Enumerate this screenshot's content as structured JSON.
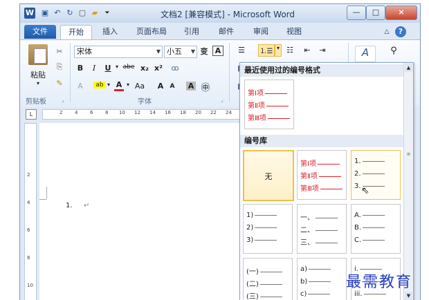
{
  "window": {
    "title": "文档2 [兼容模式] - Microsoft Word",
    "app_icon_letter": "W",
    "controls": {
      "minimize": "—",
      "maximize": "□",
      "close": "×"
    }
  },
  "quick_access": {
    "save": "▣",
    "undo": "↶",
    "redo": "↻",
    "new": "▢",
    "open": "▰",
    "more": "⏷"
  },
  "tabs": [
    {
      "label": "文件"
    },
    {
      "label": "开始"
    },
    {
      "label": "插入"
    },
    {
      "label": "页面布局"
    },
    {
      "label": "引用"
    },
    {
      "label": "邮件"
    },
    {
      "label": "审阅"
    },
    {
      "label": "视图"
    }
  ],
  "tabs_right": {
    "collapse": "△",
    "help": "?"
  },
  "ribbon": {
    "clipboard": {
      "paste_label": "粘贴",
      "group_label": "剪贴板",
      "cut": "✂",
      "copy": "⎘",
      "format_painter": "✎"
    },
    "font": {
      "font_name": "宋体",
      "font_size": "小五",
      "group_label": "字体",
      "bold": "B",
      "italic": "I",
      "underline": "U",
      "strike": "abe",
      "subscript": "x₂",
      "superscript": "x²",
      "highlight": "ab",
      "font_color": "A",
      "change_case": "Aa",
      "grow": "A",
      "shrink": "A",
      "wen": "变",
      "border": "A",
      "enclose": "㊥",
      "clear_format": "ꝏ"
    },
    "paragraph": {
      "bullets": "☰",
      "numbering": "⒈☰",
      "multilevel": "☷",
      "decrease_indent": "⇤",
      "increase_indent": "⇥"
    },
    "styles": {
      "style_icon": "A"
    },
    "editing": {
      "find_icon": "🔍"
    }
  },
  "ruler": {
    "ticks": [
      "2",
      "4",
      "6",
      "8",
      "10",
      "12",
      "14",
      "16",
      "18",
      "20",
      "22",
      "24"
    ]
  },
  "vruler": {
    "ticks": [
      "2",
      "4",
      "6",
      "8",
      "10"
    ]
  },
  "document": {
    "list_number": "1.",
    "return_mark": "↵"
  },
  "numbering_panel": {
    "recent_header": "最近使用过的编号格式",
    "library_header": "编号库",
    "recent": [
      {
        "lines": [
          "第Ⅰ项",
          "第Ⅱ项",
          "第Ⅲ项"
        ]
      }
    ],
    "library": [
      {
        "label": "无"
      },
      {
        "lines": [
          "第Ⅰ项",
          "第Ⅱ项",
          "第Ⅲ项"
        ]
      },
      {
        "lines": [
          "1.",
          "2.",
          "3."
        ]
      },
      {
        "lines": [
          "1)",
          "2)",
          "3)"
        ]
      },
      {
        "lines": [
          "一、",
          "二、",
          "三、"
        ]
      },
      {
        "lines": [
          "A.",
          "B.",
          "C."
        ]
      },
      {
        "lines": [
          "(一)",
          "(二)",
          "(三)"
        ]
      },
      {
        "lines": [
          "a)",
          "b)",
          "c)"
        ]
      },
      {
        "lines": [
          "i.",
          "ii.",
          "iii."
        ]
      }
    ]
  },
  "watermark": "最需教育",
  "colors": {
    "accent": "#2b579a",
    "selected": "#f0c04d",
    "red_text": "#e0202a"
  }
}
